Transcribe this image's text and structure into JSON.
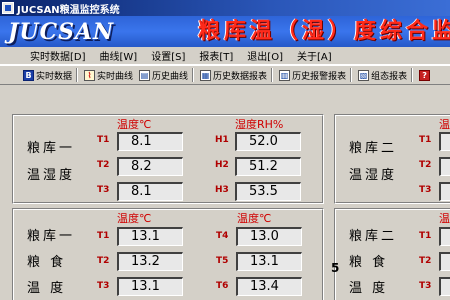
{
  "window": {
    "title": "JUCSAN粮温监控系统"
  },
  "banner": {
    "logo": "JUCSAN",
    "title": "粮库温（湿）度综合监测系"
  },
  "menu": [
    "实时数据[D]",
    "曲线[W]",
    "设置[S]",
    "报表[T]",
    "退出[O]",
    "关于[A]"
  ],
  "toolbar": [
    {
      "icon": "B",
      "label": "实时数据"
    },
    {
      "icon": "⌇",
      "label": "实时曲线"
    },
    {
      "icon": "▤",
      "label": "历史曲线"
    },
    {
      "icon": "▦",
      "label": "历史数据报表"
    },
    {
      "icon": "▥",
      "label": "历史报警报表"
    },
    {
      "icon": "▧",
      "label": "组态报表"
    },
    {
      "icon": "?",
      "label": ""
    }
  ],
  "panels": {
    "p1": {
      "name_line1": "粮库一",
      "name_line2": "温湿度",
      "temp_header": "温度℃",
      "hum_header": "湿度RH%",
      "rows": [
        {
          "tl": "T1",
          "tv": "8.1",
          "hl": "H1",
          "hv": "52.0"
        },
        {
          "tl": "T2",
          "tv": "8.2",
          "hl": "H2",
          "hv": "51.2"
        },
        {
          "tl": "T3",
          "tv": "8.1",
          "hl": "H3",
          "hv": "53.5"
        }
      ]
    },
    "p2": {
      "name_line1": "粮库二",
      "name_line2": "温湿度",
      "temp_header": "温",
      "rows": [
        {
          "tl": "T1"
        },
        {
          "tl": "T2"
        },
        {
          "tl": "T3"
        }
      ]
    },
    "p3": {
      "name_line1": "粮库一",
      "name_line2": "粮 食",
      "name_line3": "温 度",
      "temp_header": "温度℃",
      "temp_header2": "温度℃",
      "rows": [
        {
          "tl": "T1",
          "tv": "13.1",
          "tl2": "T4",
          "tv2": "13.0"
        },
        {
          "tl": "T2",
          "tv": "13.2",
          "tl2": "T5",
          "tv2": "13.1"
        },
        {
          "tl": "T3",
          "tv": "13.1",
          "tl2": "T6",
          "tv2": "13.4"
        }
      ]
    },
    "p4": {
      "name_line1": "粮库二",
      "name_line2": "粮 食",
      "name_line3": "温 度",
      "temp_header": "温",
      "rows": [
        {
          "tl": "T1"
        },
        {
          "tl": "T2"
        },
        {
          "tl": "T3"
        }
      ]
    }
  },
  "misc": {
    "five": "5"
  }
}
